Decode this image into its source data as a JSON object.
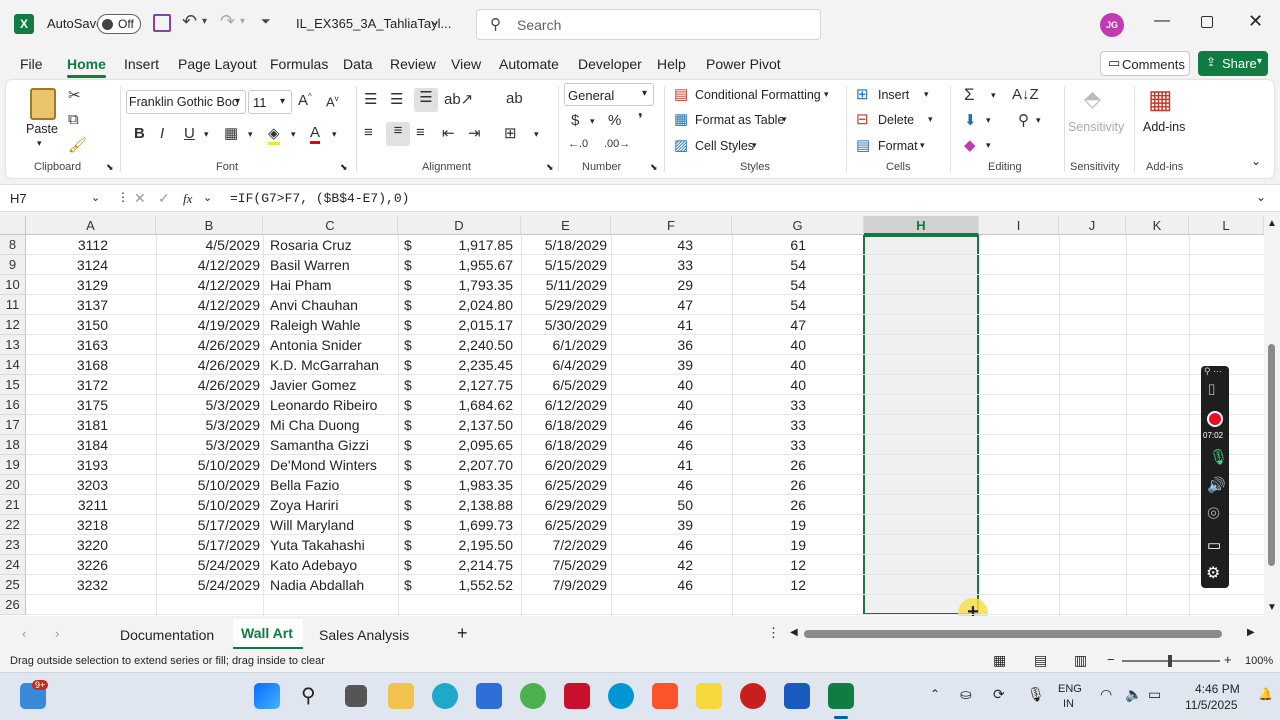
{
  "titlebar": {
    "autosave_label": "AutoSave",
    "autosave_state": "Off",
    "file_name": "IL_EX365_3A_TahliaTayl...",
    "search_placeholder": "Search",
    "avatar_initials": "JG"
  },
  "menu": {
    "items": [
      "File",
      "Home",
      "Insert",
      "Page Layout",
      "Formulas",
      "Data",
      "Review",
      "View",
      "Automate",
      "Developer",
      "Help",
      "Power Pivot"
    ],
    "active": "Home",
    "comments_label": "Comments",
    "share_label": "Share"
  },
  "ribbon": {
    "paste_label": "Paste",
    "clipboard_label": "Clipboard",
    "font_name": "Franklin Gothic Boo",
    "font_size": "11",
    "font_label": "Font",
    "alignment_label": "Alignment",
    "number_format": "General",
    "number_label": "Number",
    "conditional_formatting": "Conditional Formatting",
    "format_as_table": "Format as Table",
    "cell_styles": "Cell Styles",
    "styles_label": "Styles",
    "insert": "Insert",
    "delete": "Delete",
    "format": "Format",
    "cells_label": "Cells",
    "editing_label": "Editing",
    "sensitivity": "Sensitivity",
    "sensitivity_label": "Sensitivity",
    "addins": "Add-ins",
    "addins_label": "Add-ins",
    "bold": "B",
    "italic": "I",
    "underline": "U"
  },
  "formula_bar": {
    "name_box": "H7",
    "fx": "fx",
    "formula": "=IF(G7>F7, ($B$4-E7),0)"
  },
  "columns": [
    "A",
    "B",
    "C",
    "D",
    "E",
    "F",
    "G",
    "H",
    "I",
    "J",
    "K",
    "L"
  ],
  "selected_column": "H",
  "rows": [
    {
      "row": "8",
      "a": "3112",
      "b": "4/5/2029",
      "c": "Rosaria Cruz",
      "cur": "$",
      "d": "1,917.85",
      "e": "5/18/2029",
      "f": "43",
      "g": "61"
    },
    {
      "row": "9",
      "a": "3124",
      "b": "4/12/2029",
      "c": "Basil Warren",
      "cur": "$",
      "d": "1,955.67",
      "e": "5/15/2029",
      "f": "33",
      "g": "54"
    },
    {
      "row": "10",
      "a": "3129",
      "b": "4/12/2029",
      "c": "Hai Pham",
      "cur": "$",
      "d": "1,793.35",
      "e": "5/11/2029",
      "f": "29",
      "g": "54"
    },
    {
      "row": "11",
      "a": "3137",
      "b": "4/12/2029",
      "c": "Anvi Chauhan",
      "cur": "$",
      "d": "2,024.80",
      "e": "5/29/2029",
      "f": "47",
      "g": "54"
    },
    {
      "row": "12",
      "a": "3150",
      "b": "4/19/2029",
      "c": "Raleigh Wahle",
      "cur": "$",
      "d": "2,015.17",
      "e": "5/30/2029",
      "f": "41",
      "g": "47"
    },
    {
      "row": "13",
      "a": "3163",
      "b": "4/26/2029",
      "c": "Antonia Snider",
      "cur": "$",
      "d": "2,240.50",
      "e": "6/1/2029",
      "f": "36",
      "g": "40"
    },
    {
      "row": "14",
      "a": "3168",
      "b": "4/26/2029",
      "c": "K.D. McGarrahan",
      "cur": "$",
      "d": "2,235.45",
      "e": "6/4/2029",
      "f": "39",
      "g": "40"
    },
    {
      "row": "15",
      "a": "3172",
      "b": "4/26/2029",
      "c": "Javier Gomez",
      "cur": "$",
      "d": "2,127.75",
      "e": "6/5/2029",
      "f": "40",
      "g": "40"
    },
    {
      "row": "16",
      "a": "3175",
      "b": "5/3/2029",
      "c": "Leonardo Ribeiro",
      "cur": "$",
      "d": "1,684.62",
      "e": "6/12/2029",
      "f": "40",
      "g": "33"
    },
    {
      "row": "17",
      "a": "3181",
      "b": "5/3/2029",
      "c": "Mi Cha Duong",
      "cur": "$",
      "d": "2,137.50",
      "e": "6/18/2029",
      "f": "46",
      "g": "33"
    },
    {
      "row": "18",
      "a": "3184",
      "b": "5/3/2029",
      "c": "Samantha Gizzi",
      "cur": "$",
      "d": "2,095.65",
      "e": "6/18/2029",
      "f": "46",
      "g": "33"
    },
    {
      "row": "19",
      "a": "3193",
      "b": "5/10/2029",
      "c": "De'Mond Winters",
      "cur": "$",
      "d": "2,207.70",
      "e": "6/20/2029",
      "f": "41",
      "g": "26"
    },
    {
      "row": "20",
      "a": "3203",
      "b": "5/10/2029",
      "c": "Bella Fazio",
      "cur": "$",
      "d": "1,983.35",
      "e": "6/25/2029",
      "f": "46",
      "g": "26"
    },
    {
      "row": "21",
      "a": "3211",
      "b": "5/10/2029",
      "c": "Zoya Hariri",
      "cur": "$",
      "d": "2,138.88",
      "e": "6/29/2029",
      "f": "50",
      "g": "26"
    },
    {
      "row": "22",
      "a": "3218",
      "b": "5/17/2029",
      "c": "Will Maryland",
      "cur": "$",
      "d": "1,699.73",
      "e": "6/25/2029",
      "f": "39",
      "g": "19"
    },
    {
      "row": "23",
      "a": "3220",
      "b": "5/17/2029",
      "c": "Yuta Takahashi",
      "cur": "$",
      "d": "2,195.50",
      "e": "7/2/2029",
      "f": "46",
      "g": "19"
    },
    {
      "row": "24",
      "a": "3226",
      "b": "5/24/2029",
      "c": "Kato Adebayo",
      "cur": "$",
      "d": "2,214.75",
      "e": "7/5/2029",
      "f": "42",
      "g": "12"
    },
    {
      "row": "25",
      "a": "3232",
      "b": "5/24/2029",
      "c": "Nadia Abdallah",
      "cur": "$",
      "d": "1,552.52",
      "e": "7/9/2029",
      "f": "46",
      "g": "12"
    },
    {
      "row": "26",
      "a": "",
      "b": "",
      "c": "",
      "cur": "",
      "d": "",
      "e": "",
      "f": "",
      "g": ""
    }
  ],
  "sheet_tabs": [
    "Documentation",
    "Wall Art",
    "Sales Analysis"
  ],
  "active_sheet": "Wall Art",
  "status": {
    "message": "Drag outside selection to extend series or fill; drag inside to clear",
    "zoom": "100%"
  },
  "recorder": {
    "timer": "07:02"
  },
  "taskbar": {
    "badge": "9+",
    "lang": "ENG",
    "region": "IN",
    "time": "4:46 PM",
    "date": "11/5/2025"
  },
  "colors": {
    "accent": "#107c41",
    "selection_border": "#217346",
    "cursor_highlight": "#f5e04a"
  }
}
